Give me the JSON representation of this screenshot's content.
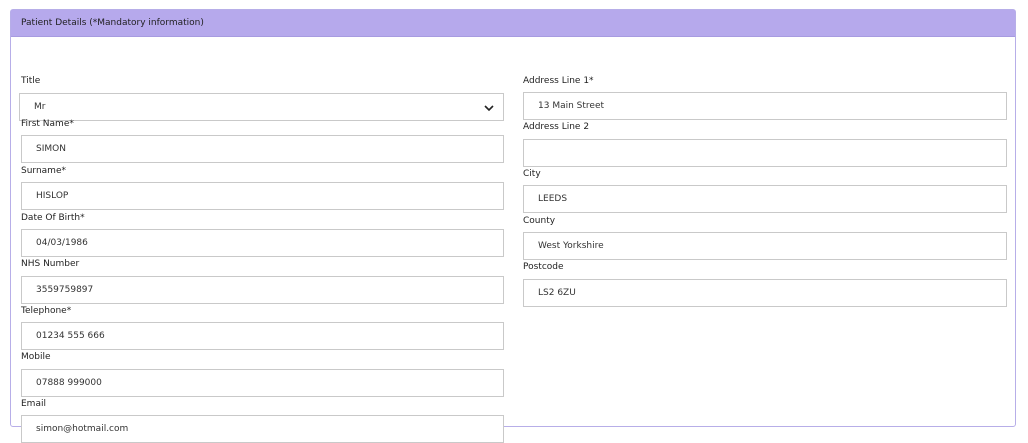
{
  "panel": {
    "title": "Patient Details (*Mandatory information)"
  },
  "left": {
    "title": {
      "label": "Title",
      "value": "Mr"
    },
    "first_name": {
      "label": "First Name*",
      "value": "SIMON"
    },
    "surname": {
      "label": "Surname*",
      "value": "HISLOP"
    },
    "dob": {
      "label": "Date Of Birth*",
      "value": "04/03/1986"
    },
    "nhs_number": {
      "label": "NHS Number",
      "value": "3559759897"
    },
    "telephone": {
      "label": "Telephone*",
      "value": "01234 555 666"
    },
    "mobile": {
      "label": "Mobile",
      "value": "07888 999000"
    },
    "email": {
      "label": "Email",
      "value": "simon@hotmail.com"
    }
  },
  "right": {
    "address1": {
      "label": "Address Line 1*",
      "value": "13 Main Street"
    },
    "address2": {
      "label": "Address Line 2",
      "value": ""
    },
    "city": {
      "label": "City",
      "value": "LEEDS"
    },
    "county": {
      "label": "County",
      "value": "West Yorkshire"
    },
    "postcode": {
      "label": "Postcode",
      "value": "LS2 6ZU"
    }
  },
  "icons": {
    "select_arrow": "chevron-down-icon"
  }
}
